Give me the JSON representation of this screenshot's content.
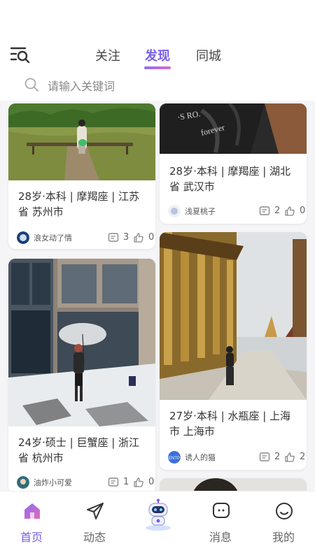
{
  "header": {
    "tabs": [
      {
        "label": "关注",
        "active": false
      },
      {
        "label": "发现",
        "active": true
      },
      {
        "label": "同城",
        "active": false
      }
    ],
    "accent_color": "#7b5cf0"
  },
  "search": {
    "placeholder": "请输入关键词"
  },
  "feed": {
    "left": [
      {
        "desc": "28岁·本科 | 摩羯座 | 江苏省 苏州市",
        "user": "浪女动了情",
        "comments": "3",
        "likes": "0"
      },
      {
        "desc": "24岁·硕士 | 巨蟹座 | 浙江省 杭州市",
        "user": "油炸小可爱",
        "comments": "1",
        "likes": "0"
      }
    ],
    "right": [
      {
        "desc": "28岁·本科 | 摩羯座 | 湖北省 武汉市",
        "user": "浅夏桃子",
        "comments": "2",
        "likes": "0"
      },
      {
        "desc": "27岁·本科 | 水瓶座 | 上海市 上海市",
        "user": "诱人的猫",
        "comments": "2",
        "likes": "2"
      }
    ]
  },
  "bottom_nav": [
    {
      "label": "首页",
      "icon": "home-icon",
      "active": true
    },
    {
      "label": "动态",
      "icon": "send-icon",
      "active": false
    },
    {
      "label": "",
      "icon": "robot-icon",
      "active": false
    },
    {
      "label": "消息",
      "icon": "message-icon",
      "active": false
    },
    {
      "label": "我的",
      "icon": "profile-icon",
      "active": false
    }
  ]
}
